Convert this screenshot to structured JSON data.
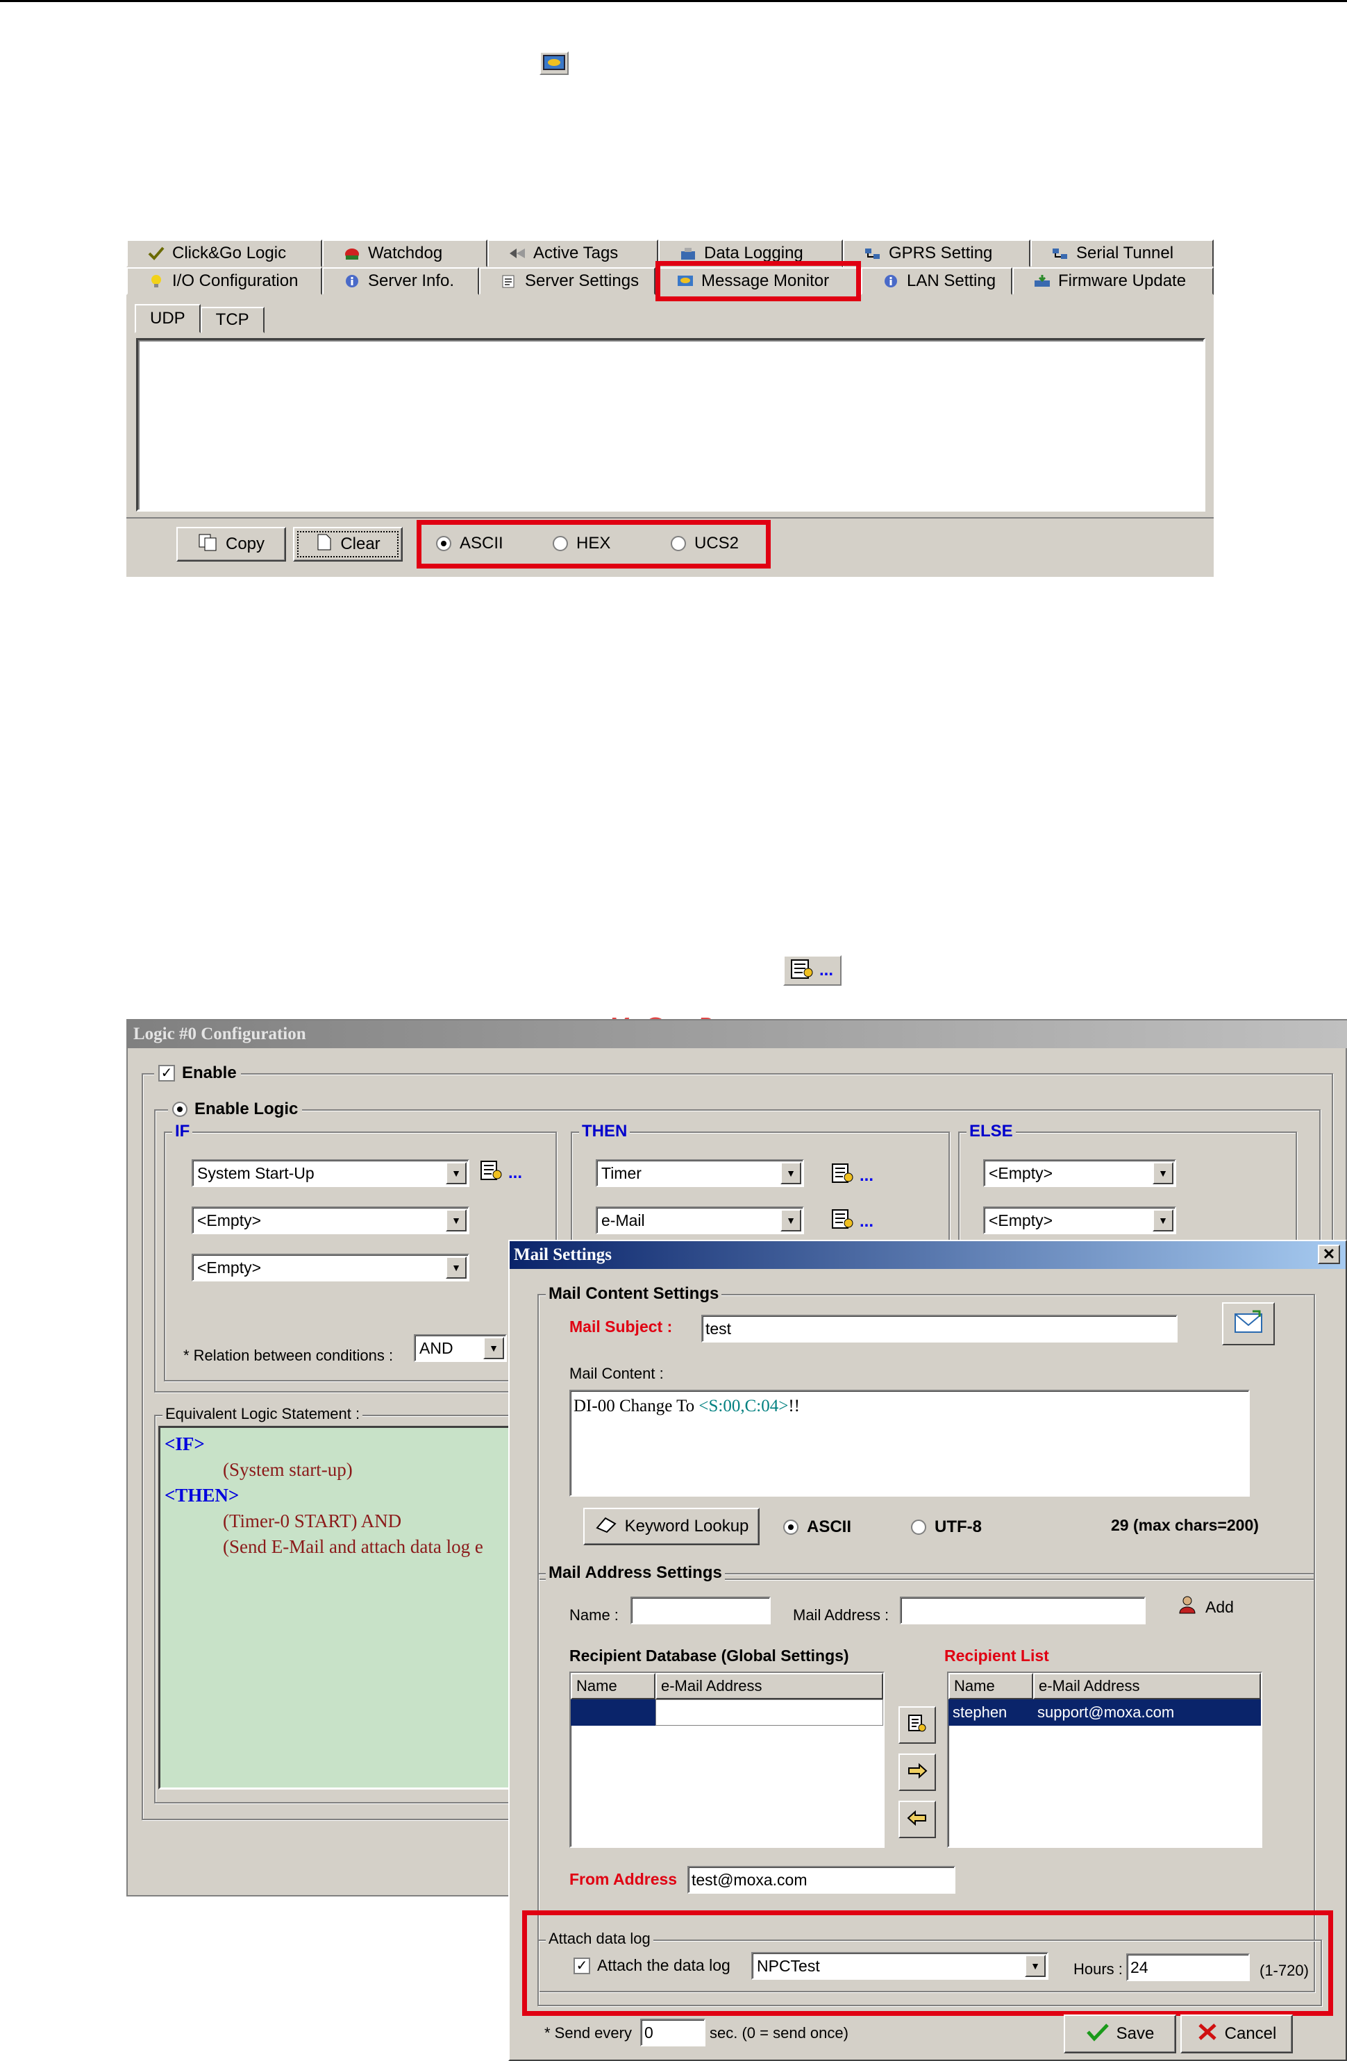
{
  "panel1": {
    "tabs_row1": [
      "Click&Go Logic",
      "Watchdog",
      "Active Tags",
      "Data Logging",
      "GPRS Setting",
      "Serial Tunnel"
    ],
    "tabs_row2": [
      "I/O Configuration",
      "Server Info.",
      "Server Settings",
      "Message Monitor",
      "LAN Setting",
      "Firmware Update"
    ],
    "subtabs": [
      "UDP",
      "TCP"
    ],
    "copy_label": "Copy",
    "clear_label": "Clear",
    "encodings": [
      "ASCII",
      "HEX",
      "UCS2"
    ],
    "selected_encoding": "ASCII"
  },
  "watermark": "McGrp.Ru",
  "lookup_dots": "...",
  "logic": {
    "title": "Logic #0 Configuration",
    "enable_label": "Enable",
    "enable_logic_label": "Enable Logic",
    "if_label": "IF",
    "then_label": "THEN",
    "else_label": "ELSE",
    "if_conditions": [
      "System Start-Up",
      "<Empty>",
      "<Empty>"
    ],
    "then_actions": [
      "Timer",
      "e-Mail"
    ],
    "else_actions": [
      "<Empty>",
      "<Empty>"
    ],
    "relation_label": "* Relation between conditions :",
    "relation_value": "AND",
    "equiv_label": "Equivalent Logic Statement :",
    "statement": {
      "if_kw": "<IF>",
      "if_line": "(System start-up)",
      "then_kw": "<THEN>",
      "then_line1": "(Timer-0 START)  AND",
      "then_line2": "(Send E-Mail and attach data log e"
    }
  },
  "mail": {
    "title": "Mail Settings",
    "content_group": "Mail Content Settings",
    "subject_label": "Mail Subject :",
    "subject_value": "test",
    "content_label": "Mail Content :",
    "content_pre": "DI-00 Change To ",
    "content_kw": "<S:00,C:04>",
    "content_post": "!!",
    "keyword_lookup": "Keyword Lookup",
    "enc_ascii": "ASCII",
    "enc_utf8": "UTF-8",
    "char_count": "29 (max chars=200)",
    "address_group": "Mail Address Settings",
    "name_label": "Name :",
    "name_value": "",
    "address_label": "Mail Address :",
    "address_value": "",
    "add_label": "Add",
    "db_label": "Recipient Database (Global Settings)",
    "recipient_label": "Recipient List",
    "col_name": "Name",
    "col_email": "e-Mail Address",
    "recipients": [
      {
        "name": "stephen",
        "email": "support@moxa.com"
      }
    ],
    "from_label": "From Address",
    "from_value": "test@moxa.com",
    "attach_group": "Attach data log",
    "attach_label": "Attach the data log",
    "attach_value": "NPCTest",
    "hours_label": "Hours :",
    "hours_value": "24",
    "hours_range": "(1-720)",
    "send_every_label": "* Send every",
    "send_every_value": "0",
    "send_every_suffix": "sec. (0 = send once)",
    "save_label": "Save",
    "cancel_label": "Cancel"
  },
  "colors": {
    "highlight": "#e00012",
    "selection": "#0a246a",
    "logic_bg": "#c8e2c8"
  }
}
